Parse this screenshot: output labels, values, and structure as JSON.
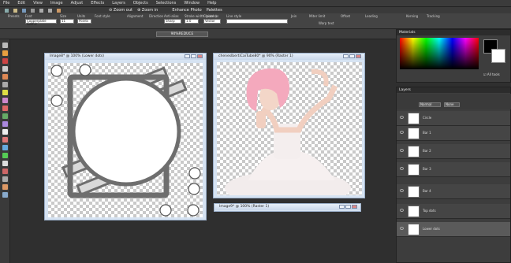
{
  "menu": [
    "File",
    "Edit",
    "View",
    "Image",
    "Adjust",
    "Effects",
    "Layers",
    "Objects",
    "Selections",
    "Window",
    "Help"
  ],
  "toolbar": {
    "zoom_out": "Zoom out",
    "zoom_in": "Zoom in",
    "enhance": "Enhance Photo",
    "palettes": "Palettes"
  },
  "options": {
    "presets": "Presets",
    "font": "Font",
    "font_value": "Copperplate Gothic",
    "size": "Size",
    "size_value": "11",
    "units": "Units",
    "units_value": "Points",
    "font_style": "Font style",
    "alignment": "Alignment",
    "direction": "Direction",
    "anti_alias": "Anti-alias",
    "anti_alias_value": "Sharp",
    "stroke_width": "Stroke width (pixels)",
    "stroke_value": "1.0",
    "create_as": "Create as",
    "create_value": "Vector",
    "line_style": "Line style",
    "join": "Join",
    "miter": "Miter limit",
    "keep_text": "Warp text",
    "offset": "Offset",
    "leading": "Leading",
    "kerning": "Kerning",
    "tracking": "Tracking"
  },
  "zoom_select": "90%REDUCE",
  "windows": [
    {
      "title": "Image8* @ 100% (Lower dots)"
    },
    {
      "title": "cheneslbertiCaiTube80* @ 90% (Raster 1)"
    },
    {
      "title": "Image9* @ 100% (Raster 1)"
    }
  ],
  "panels": {
    "materials": "Materials",
    "all_tools": "All tools",
    "layers": "Layers",
    "blend": "Normal",
    "blend_none": "None",
    "layer_items": [
      "Circle",
      "Bar 1",
      "Bar 2",
      "Bar 3",
      "Bar 4",
      "Top dots",
      "Lower dots"
    ]
  }
}
